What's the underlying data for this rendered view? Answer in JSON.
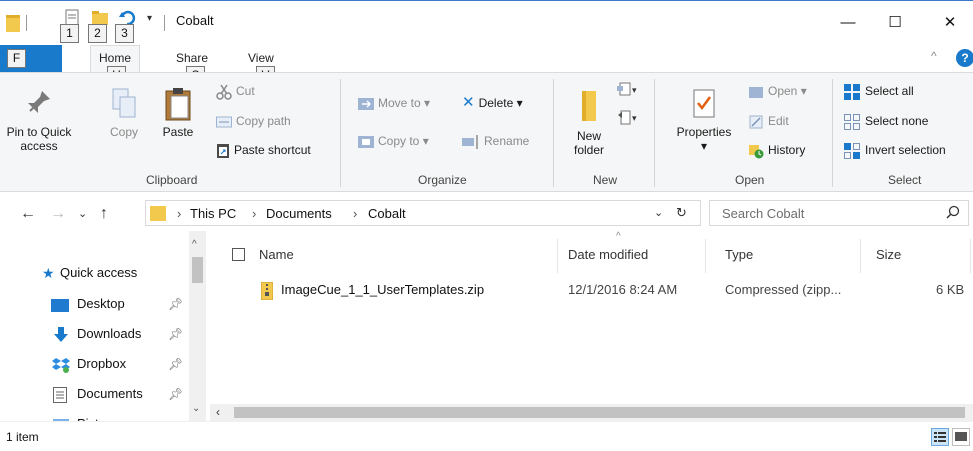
{
  "window": {
    "title": "Cobalt",
    "qat_keytips": [
      "1",
      "2",
      "3"
    ],
    "minimize": "—",
    "maximize": "☐",
    "close": "✕"
  },
  "ribbon_tabs": {
    "file": {
      "keytip": "F"
    },
    "tabs": [
      {
        "label": "Home",
        "keytip": "H"
      },
      {
        "label": "Share",
        "keytip": "S"
      },
      {
        "label": "View",
        "keytip": "V"
      }
    ],
    "help": "?"
  },
  "clipboard": {
    "pin_label_1": "Pin to Quick",
    "pin_label_2": "access",
    "copy": "Copy",
    "paste": "Paste",
    "cut": "Cut",
    "copy_path": "Copy path",
    "paste_shortcut": "Paste shortcut",
    "group": "Clipboard"
  },
  "organize": {
    "move_to": "Move to",
    "copy_to": "Copy to",
    "delete": "Delete",
    "rename": "Rename",
    "group": "Organize"
  },
  "new_group": {
    "new_folder_1": "New",
    "new_folder_2": "folder",
    "group": "New"
  },
  "open_group": {
    "properties": "Properties",
    "open": "Open",
    "edit": "Edit",
    "history": "History",
    "group": "Open"
  },
  "select_group": {
    "select_all": "Select all",
    "select_none": "Select none",
    "invert_selection": "Invert selection",
    "group": "Select"
  },
  "address": {
    "breadcrumbs": [
      "This PC",
      "Documents",
      "Cobalt"
    ],
    "search_placeholder": "Search Cobalt"
  },
  "nav_pane": {
    "items": [
      {
        "label": "Quick access"
      },
      {
        "label": "Desktop"
      },
      {
        "label": "Downloads"
      },
      {
        "label": "Dropbox"
      },
      {
        "label": "Documents"
      },
      {
        "label": "Pictures"
      }
    ]
  },
  "file_list": {
    "columns": [
      "Name",
      "Date modified",
      "Type",
      "Size"
    ],
    "rows": [
      {
        "name": "ImageCue_1_1_UserTemplates.zip",
        "date": "12/1/2016 8:24 AM",
        "type": "Compressed (zipp...",
        "size": "6 KB"
      }
    ]
  },
  "status": {
    "item_count": "1 item"
  },
  "colors": {
    "accent": "#1979ca",
    "folder": "#f2c94c",
    "ribbon_bg": "#f5f6f7"
  }
}
